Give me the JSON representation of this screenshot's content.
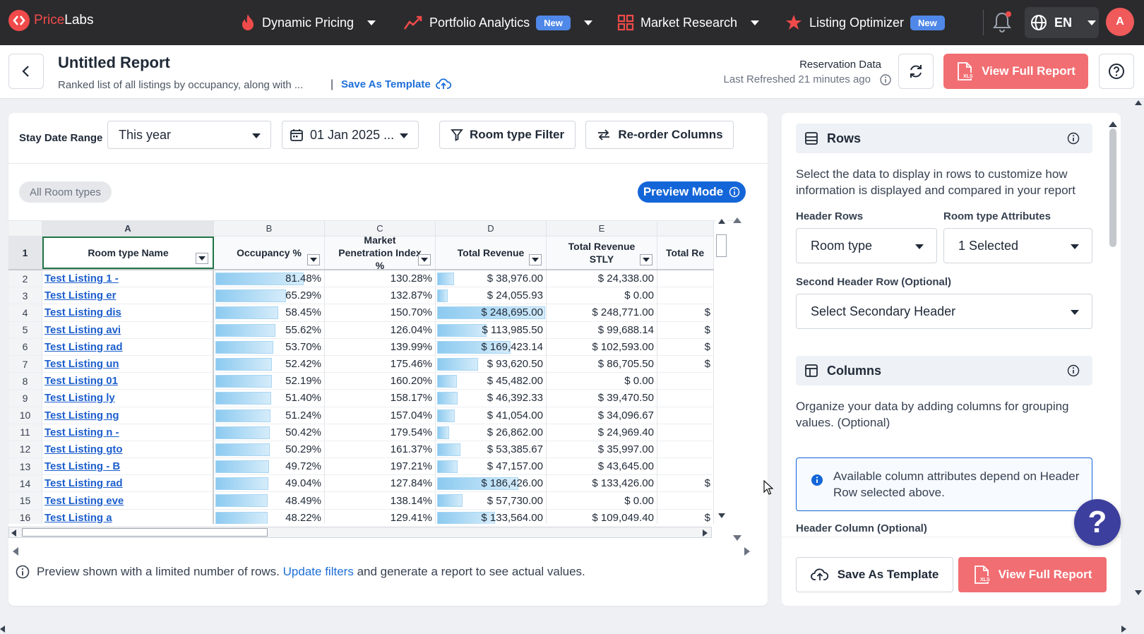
{
  "nav": {
    "logo": {
      "price": "Price",
      "labs": "Labs"
    },
    "items": [
      {
        "label": "Dynamic Pricing",
        "icon": "flame-icon"
      },
      {
        "label": "Portfolio Analytics",
        "badge": "New",
        "icon": "trend-icon"
      },
      {
        "label": "Market Research",
        "icon": "grid-icon"
      },
      {
        "label": "Listing Optimizer",
        "badge": "New",
        "icon": "star-icon"
      }
    ],
    "language": "EN",
    "avatar_initial": "A"
  },
  "header": {
    "title": "Untitled Report",
    "subtitle": "Ranked list of all listings by occupancy, along with ...",
    "separator": "|",
    "save_template": "Save As Template",
    "reservation_title": "Reservation Data",
    "last_refreshed": "Last Refreshed 21 minutes ago",
    "view_full_report": "View Full Report"
  },
  "filters": {
    "stay_date_label": "Stay Date Range",
    "range_value": "This year",
    "date_value": "01 Jan 2025 ...",
    "room_type_filter": "Room type Filter",
    "reorder_columns": "Re-order Columns",
    "chip": "All Room types",
    "preview_mode": "Preview Mode"
  },
  "grid": {
    "column_letters": [
      "A",
      "B",
      "C",
      "D",
      "E",
      ""
    ],
    "header_row_number": "1",
    "headers": [
      "Room type Name",
      "Occupancy %",
      "Market Penetration Index %",
      "Total Revenue",
      "Total Revenue STLY",
      "Total Re"
    ],
    "rows": [
      {
        "n": "2",
        "name": "Test Listing 1 -",
        "occ": "81.48%",
        "occ_pct": 81.48,
        "mpi": "130.28%",
        "rev": "$ 38,976.00",
        "rev_num": 38976.0,
        "stly": "$ 24,338.00",
        "extra": ""
      },
      {
        "n": "3",
        "name": "Test Listing er",
        "occ": "65.29%",
        "occ_pct": 65.29,
        "mpi": "132.87%",
        "rev": "$ 24,055.93",
        "rev_num": 24055.93,
        "stly": "$ 0.00",
        "extra": ""
      },
      {
        "n": "4",
        "name": "Test Listing dis",
        "occ": "58.45%",
        "occ_pct": 58.45,
        "mpi": "150.70%",
        "rev": "$ 248,695.00",
        "rev_num": 248695.0,
        "stly": "$ 248,771.00",
        "extra": "$"
      },
      {
        "n": "5",
        "name": "Test Listing avi",
        "occ": "55.62%",
        "occ_pct": 55.62,
        "mpi": "126.04%",
        "rev": "$ 113,985.50",
        "rev_num": 113985.5,
        "stly": "$ 99,688.14",
        "extra": "$"
      },
      {
        "n": "6",
        "name": "Test Listing rad",
        "occ": "53.70%",
        "occ_pct": 53.7,
        "mpi": "139.99%",
        "rev": "$ 169,423.14",
        "rev_num": 169423.14,
        "stly": "$ 102,593.00",
        "extra": "$"
      },
      {
        "n": "7",
        "name": "Test Listing  un",
        "occ": "52.42%",
        "occ_pct": 52.42,
        "mpi": "175.46%",
        "rev": "$ 93,620.50",
        "rev_num": 93620.5,
        "stly": "$ 86,705.50",
        "extra": "$"
      },
      {
        "n": "8",
        "name": "Test Listing 01",
        "occ": "52.19%",
        "occ_pct": 52.19,
        "mpi": "160.20%",
        "rev": "$ 45,482.00",
        "rev_num": 45482.0,
        "stly": "$ 0.00",
        "extra": ""
      },
      {
        "n": "9",
        "name": "Test Listing ly",
        "occ": "51.40%",
        "occ_pct": 51.4,
        "mpi": "158.17%",
        "rev": "$ 46,392.33",
        "rev_num": 46392.33,
        "stly": "$ 39,470.50",
        "extra": ""
      },
      {
        "n": "10",
        "name": "Test Listing ng",
        "occ": "51.24%",
        "occ_pct": 51.24,
        "mpi": "157.04%",
        "rev": "$ 41,054.00",
        "rev_num": 41054.0,
        "stly": "$ 34,096.67",
        "extra": ""
      },
      {
        "n": "11",
        "name": "Test Listing n -",
        "occ": "50.42%",
        "occ_pct": 50.42,
        "mpi": "179.54%",
        "rev": "$ 26,862.00",
        "rev_num": 26862.0,
        "stly": "$ 24,969.40",
        "extra": ""
      },
      {
        "n": "12",
        "name": "Test Listing gto",
        "occ": "50.29%",
        "occ_pct": 50.29,
        "mpi": "161.37%",
        "rev": "$ 53,385.67",
        "rev_num": 53385.67,
        "stly": "$ 35,997.00",
        "extra": ""
      },
      {
        "n": "13",
        "name": "Test Listing - B",
        "occ": "49.72%",
        "occ_pct": 49.72,
        "mpi": "197.21%",
        "rev": "$ 47,157.00",
        "rev_num": 47157.0,
        "stly": "$ 43,645.00",
        "extra": ""
      },
      {
        "n": "14",
        "name": "Test Listing rad",
        "occ": "49.04%",
        "occ_pct": 49.04,
        "mpi": "127.84%",
        "rev": "$ 186,426.00",
        "rev_num": 186426.0,
        "stly": "$ 133,426.00",
        "extra": "$"
      },
      {
        "n": "15",
        "name": "Test Listing eve",
        "occ": "48.49%",
        "occ_pct": 48.49,
        "mpi": "138.14%",
        "rev": "$ 57,730.00",
        "rev_num": 57730.0,
        "stly": "$ 0.00",
        "extra": ""
      },
      {
        "n": "16",
        "name": "Test Listing a",
        "occ": "48.22%",
        "occ_pct": 48.22,
        "mpi": "129.41%",
        "rev": "$ 133,564.00",
        "rev_num": 133564.0,
        "stly": "$ 109,049.40",
        "extra": "$"
      }
    ]
  },
  "footnote": {
    "before": "Preview shown with a limited number of rows.",
    "link": "Update filters",
    "after": "and generate a report to see actual values."
  },
  "panel": {
    "rows_title": "Rows",
    "rows_desc": "Select the data to display in rows to customize how information is displayed and compared in your report",
    "header_rows_label": "Header Rows",
    "header_rows_value": "Room type",
    "attributes_label": "Room type Attributes",
    "attributes_value": "1 Selected",
    "second_header_label": "Second Header Row (Optional)",
    "second_header_value": "Select Secondary Header",
    "columns_title": "Columns",
    "columns_desc": "Organize your data by adding columns for grouping values. (Optional)",
    "info_text": "Available column attributes depend on Header Row selected above.",
    "header_column_label": "Header Column (Optional)",
    "save_template": "Save As Template",
    "view_full_report": "View Full Report"
  },
  "colors": {
    "nav_bg": "#2b2b2d",
    "brand_red": "#f04a4a",
    "primary_blue": "#1466d8",
    "cta_red": "#f16e72",
    "bar_blue": "#8ccaf0"
  }
}
